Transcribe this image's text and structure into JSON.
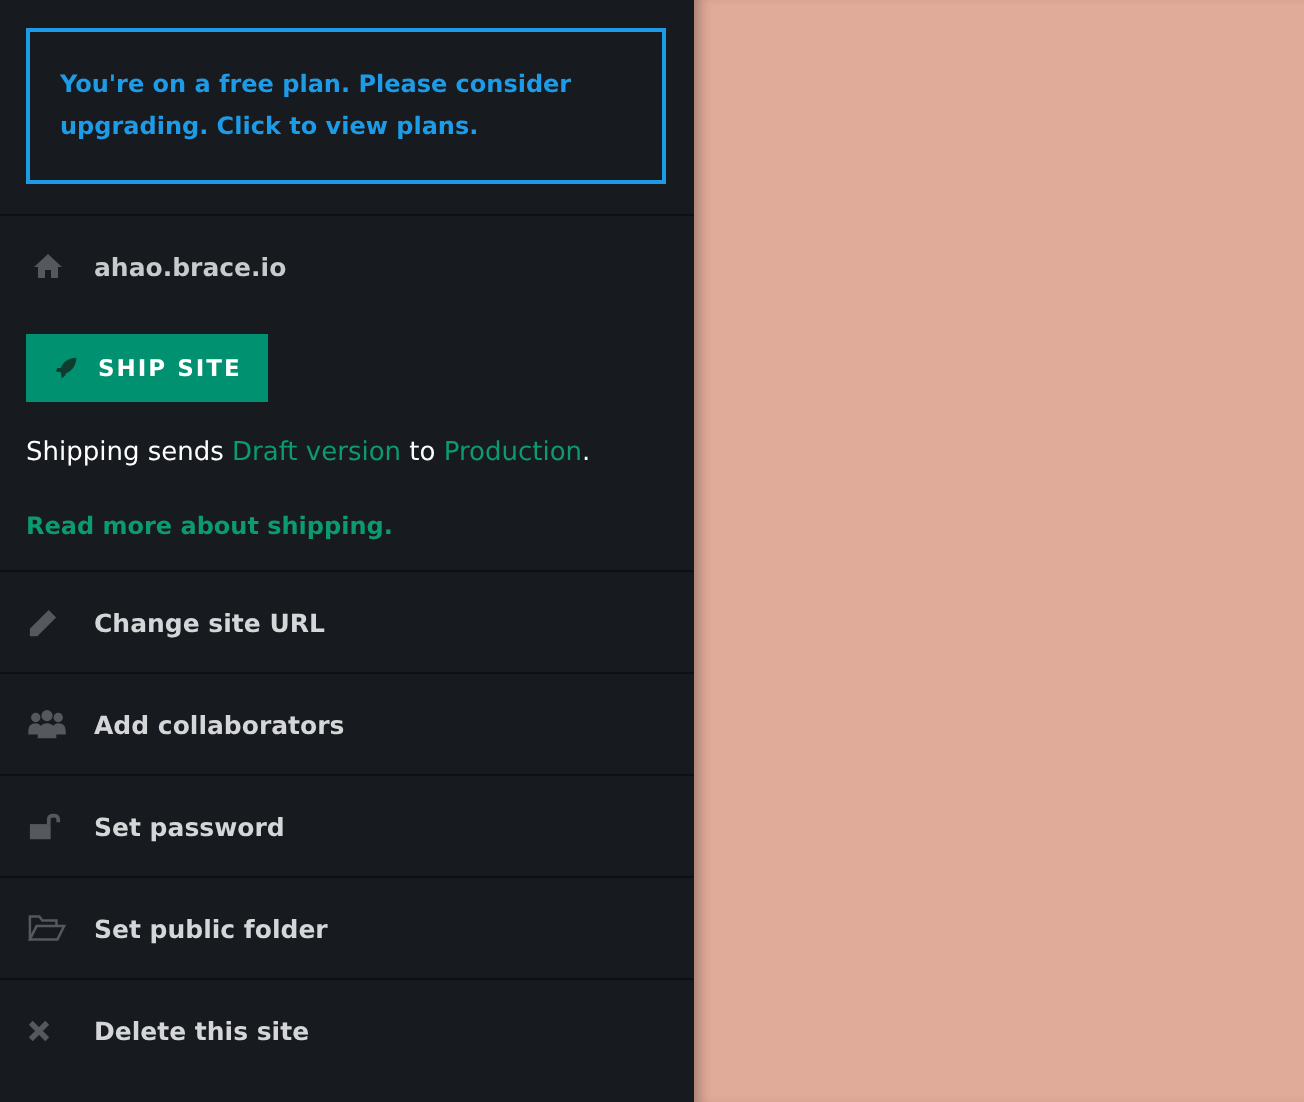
{
  "upgrade_notice": "You're on a free plan. Please consider upgrading. Click to view plans.",
  "site": {
    "name": "ahao.brace.io"
  },
  "ship_button": "SHIP SITE",
  "shipping_note": {
    "before": "Shipping sends ",
    "from": "Draft version",
    "middle": " to ",
    "to": "Production",
    "after": "."
  },
  "read_more": "Read more about shipping.",
  "menu": [
    {
      "kind": "pencil",
      "label": "Change site URL"
    },
    {
      "kind": "people",
      "label": "Add collaborators"
    },
    {
      "kind": "lock",
      "label": "Set password"
    },
    {
      "kind": "folder",
      "label": "Set public folder"
    },
    {
      "kind": "cross",
      "label": "Delete this site"
    }
  ]
}
